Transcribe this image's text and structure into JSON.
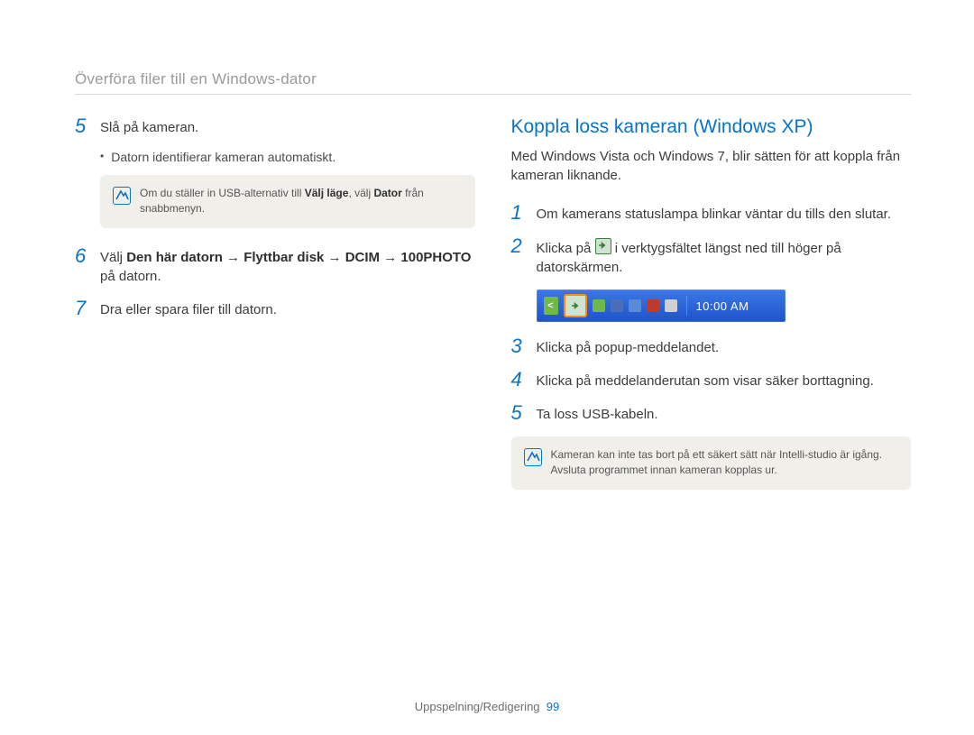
{
  "header": {
    "title": "Överföra filer till en Windows-dator"
  },
  "left": {
    "steps": [
      {
        "num": "5",
        "text": "Slå på kameran.",
        "bullet": "Datorn identifierar kameran automatiskt.",
        "note_parts": {
          "a": "Om du ställer in USB-alternativ till ",
          "b": "Välj läge",
          "c": ", välj ",
          "d": "Dator",
          "e": " från snabbmenyn."
        }
      },
      {
        "num": "6",
        "rich": {
          "pre": "Välj ",
          "bold": "Den här datorn → Flyttbar disk → DCIM → 100PHOTO",
          "post": " på datorn."
        }
      },
      {
        "num": "7",
        "text": "Dra eller spara filer till datorn."
      }
    ]
  },
  "right": {
    "title": "Koppla loss kameran (Windows XP)",
    "intro": "Med Windows Vista och Windows 7, blir sätten för att koppla från kameran liknande.",
    "steps": [
      {
        "num": "1",
        "text": "Om kamerans statuslampa blinkar väntar du tills den slutar."
      },
      {
        "num": "2",
        "parts": {
          "a": "Klicka på ",
          "b": " i verktygsfältet längst ned till höger på datorskärmen."
        },
        "has_inline_icon": true
      },
      {
        "num": "3",
        "text": "Klicka på popup-meddelandet."
      },
      {
        "num": "4",
        "text": "Klicka på meddelanderutan som visar säker borttagning."
      },
      {
        "num": "5",
        "text": "Ta loss USB-kabeln."
      }
    ],
    "clock": "10:00 AM",
    "note": "Kameran kan inte tas bort på ett säkert sätt när Intelli-studio är igång. Avsluta programmet innan kameran kopplas ur."
  },
  "footer": {
    "label": "Uppspelning/Redigering",
    "page": "99"
  }
}
